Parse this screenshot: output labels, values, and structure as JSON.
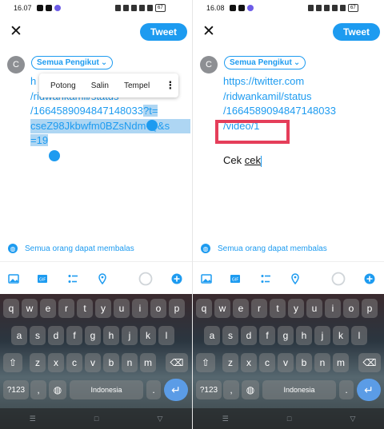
{
  "left": {
    "status": {
      "time": "16.07",
      "battery": "67"
    },
    "header": {
      "tweet_label": "Tweet"
    },
    "compose": {
      "avatar_letter": "C",
      "audience": "Semua Pengikut",
      "lines": [
        "h",
        "/ridwankamil/status",
        "/1664589094847148033",
        "?t=",
        "cseZ98Jkbwfm0BZsNdm-Q&s",
        "=19"
      ]
    },
    "context_menu": {
      "items": [
        "Potong",
        "Salin",
        "Tempel"
      ],
      "more": "⋮"
    },
    "reply_setting": "Semua orang dapat membalas",
    "keyboard": {
      "row1": [
        "q",
        "w",
        "e",
        "r",
        "t",
        "y",
        "u",
        "i",
        "o",
        "p"
      ],
      "row2": [
        "a",
        "s",
        "d",
        "f",
        "g",
        "h",
        "j",
        "k",
        "l"
      ],
      "row3": [
        "⇧",
        "z",
        "x",
        "c",
        "v",
        "b",
        "n",
        "m",
        "⌫"
      ],
      "symbols": "?123",
      "comma": ",",
      "space_label": "Indonesia",
      "period": ".",
      "enter": "↵"
    },
    "nav": [
      "☰",
      "□",
      "▽"
    ]
  },
  "right": {
    "status": {
      "time": "16.08",
      "battery": "67"
    },
    "header": {
      "tweet_label": "Tweet"
    },
    "compose": {
      "avatar_letter": "C",
      "audience": "Semua Pengikut",
      "lines": [
        "https://twitter.com",
        "/ridwankamil/status",
        "/1664589094847148033",
        "/video/1"
      ],
      "extra_line_prefix": "Cek ",
      "extra_line_word": "cek"
    },
    "reply_setting": "Semua orang dapat membalas",
    "keyboard": {
      "row1": [
        "q",
        "w",
        "e",
        "r",
        "t",
        "y",
        "u",
        "i",
        "o",
        "p"
      ],
      "row2": [
        "a",
        "s",
        "d",
        "f",
        "g",
        "h",
        "j",
        "k",
        "l"
      ],
      "row3": [
        "⇧",
        "z",
        "x",
        "c",
        "v",
        "b",
        "n",
        "m",
        "⌫"
      ],
      "symbols": "?123",
      "comma": ",",
      "space_label": "Indonesia",
      "period": ".",
      "enter": "↵"
    },
    "nav": [
      "☰",
      "□",
      "▽"
    ]
  },
  "colors": {
    "accent": "#1d9bf0",
    "highlight": "#e53e5a",
    "selection": "#aed6f3"
  }
}
